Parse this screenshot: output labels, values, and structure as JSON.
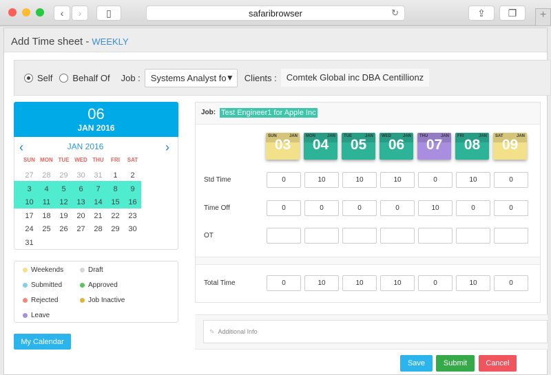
{
  "browser": {
    "url": "safaribrowser"
  },
  "header": {
    "title": "Add Time sheet -",
    "mode": "WEEKLY"
  },
  "filter": {
    "self_label": "Self",
    "behalf_label": "Behalf Of",
    "job_label": "Job :",
    "job_value": "Systems Analyst fo",
    "clients_label": "Clients :",
    "clients_value": "Comtek Global inc DBA Centillionz"
  },
  "calendar": {
    "day": "06",
    "month_year": "JAN 2016",
    "nav_title": "JAN 2016",
    "weekdays": [
      "SUN",
      "MON",
      "TUE",
      "WED",
      "THU",
      "FRI",
      "SAT"
    ],
    "weeks": [
      [
        "27",
        "28",
        "29",
        "30",
        "31",
        "1",
        "2"
      ],
      [
        "3",
        "4",
        "5",
        "6",
        "7",
        "8",
        "9"
      ],
      [
        "10",
        "11",
        "12",
        "13",
        "14",
        "15",
        "16"
      ],
      [
        "17",
        "18",
        "19",
        "20",
        "21",
        "22",
        "23"
      ],
      [
        "24",
        "25",
        "26",
        "27",
        "28",
        "29",
        "30"
      ],
      [
        "31",
        "",
        "",
        "",
        "",
        "",
        ""
      ]
    ]
  },
  "legend": [
    {
      "label": "Weekends",
      "color": "#f3e18a"
    },
    {
      "label": "Draft",
      "color": "#d6d6d6"
    },
    {
      "label": "Submitted",
      "color": "#7fd0f3"
    },
    {
      "label": "Approved",
      "color": "#5cc45c"
    },
    {
      "label": "Rejected",
      "color": "#ee8a78"
    },
    {
      "label": "Job Inactive",
      "color": "#e0b43a"
    },
    {
      "label": "Leave",
      "color": "#a98ee0"
    }
  ],
  "my_calendar": "My Calendar",
  "timesheet": {
    "job_label": "Job:",
    "job_value": "Test Engineer1 for Apple Inc",
    "days": [
      {
        "dow": "SUN",
        "mon": "JAN",
        "num": "03",
        "color": "#f3e18a"
      },
      {
        "dow": "MON",
        "mon": "JAN",
        "num": "04",
        "color": "#2db398"
      },
      {
        "dow": "TUE",
        "mon": "JAN",
        "num": "05",
        "color": "#2db398"
      },
      {
        "dow": "WED",
        "mon": "JAN",
        "num": "06",
        "color": "#2db398"
      },
      {
        "dow": "THU",
        "mon": "JAN",
        "num": "07",
        "color": "#a98ee0"
      },
      {
        "dow": "FRI",
        "mon": "JAN",
        "num": "08",
        "color": "#2db398"
      },
      {
        "dow": "SAT",
        "mon": "JAN",
        "num": "09",
        "color": "#f3e18a"
      }
    ],
    "rows": [
      {
        "label": "Std Time",
        "values": [
          "0",
          "10",
          "10",
          "10",
          "0",
          "10",
          "0"
        ]
      },
      {
        "label": "Time Off",
        "values": [
          "0",
          "0",
          "0",
          "0",
          "10",
          "0",
          "0"
        ]
      },
      {
        "label": "OT",
        "values": [
          "",
          "",
          "",
          "",
          "",
          "",
          ""
        ]
      }
    ],
    "total": {
      "label": "Total Time",
      "values": [
        "0",
        "10",
        "10",
        "10",
        "0",
        "10",
        "0"
      ]
    }
  },
  "additional_info_placeholder": "Additional Info",
  "actions": {
    "save": "Save",
    "submit": "Submit",
    "cancel": "Cancel"
  }
}
